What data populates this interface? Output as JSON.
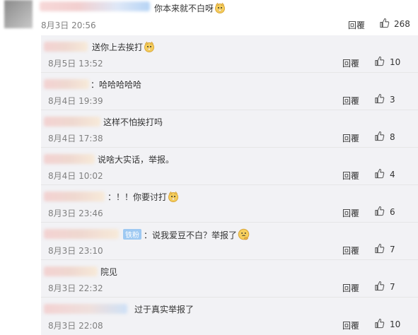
{
  "top_comment": {
    "text": "你本来就不白呀",
    "time": "8月3日 20:56",
    "reply_label": "回覆",
    "likes": "268",
    "emoji": "doge-emoji"
  },
  "replies": [
    {
      "text": "送你上去挨打",
      "time": "8月5日 13:52",
      "reply_label": "回覆",
      "likes": "10",
      "emoji": "doge-emoji"
    },
    {
      "text": "：哈哈哈哈哈",
      "time": "8月4日 19:39",
      "reply_label": "回覆",
      "likes": "3"
    },
    {
      "text": "这样不怕挨打吗",
      "time": "8月4日 17:38",
      "reply_label": "回覆",
      "likes": "8"
    },
    {
      "text": "说啥大实话，举报。",
      "time": "8月4日 10:02",
      "reply_label": "回覆",
      "likes": "4"
    },
    {
      "text": "：！！你要讨打",
      "time": "8月3日 23:46",
      "reply_label": "回覆",
      "likes": "6",
      "emoji": "doge-emoji"
    },
    {
      "badge": "铁粉",
      "text": "：说我爱豆不白？举报了",
      "time": "8月3日 23:10",
      "reply_label": "回覆",
      "likes": "7",
      "emoji": "thinking-emoji"
    },
    {
      "text": "院见",
      "time": "8月3日 22:32",
      "reply_label": "回覆",
      "likes": "7"
    },
    {
      "text": "过于真实举报了",
      "time": "8月3日 22:08",
      "reply_label": "回覆",
      "likes": "10"
    }
  ]
}
